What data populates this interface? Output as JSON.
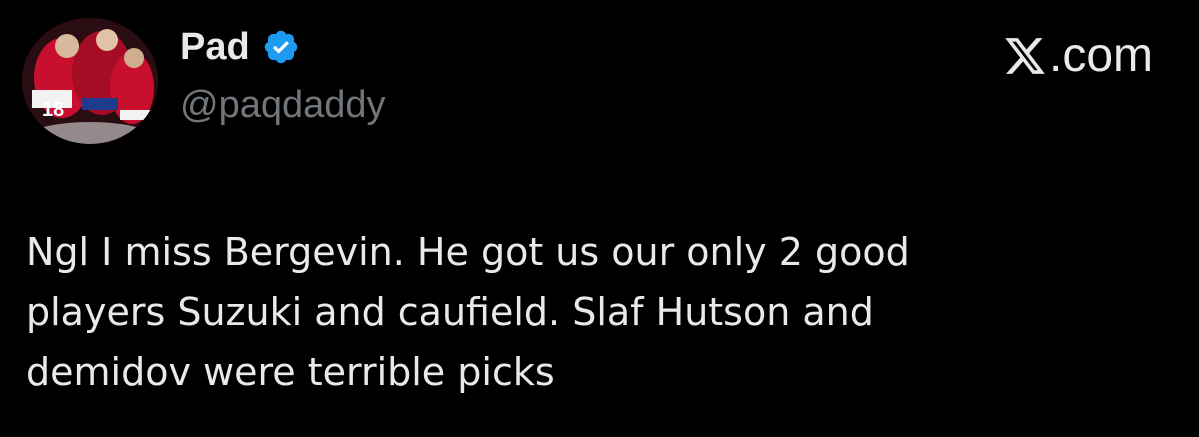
{
  "author": {
    "display_name": "Pad",
    "handle": "@paqdaddy",
    "verified": true,
    "avatar_icon": "hockey-team-celebration-avatar"
  },
  "brand": {
    "icon": "x-logo-icon",
    "text": ".com"
  },
  "tweet": {
    "text": "Ngl I miss Bergevin. He got us our only 2 good\nplayers Suzuki and caufield. Slaf Hutson and\ndemidov were terrible picks"
  },
  "colors": {
    "background": "#000000",
    "text": "#e7e9ea",
    "handle": "#71767b",
    "verified": "#1d9bf0"
  }
}
